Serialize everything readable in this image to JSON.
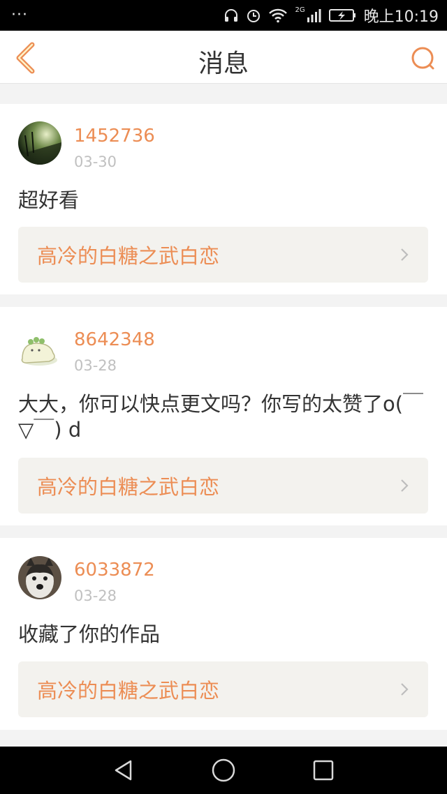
{
  "status_bar": {
    "dots": "···",
    "network": "2G",
    "time": "晚上10:19"
  },
  "header": {
    "title": "消息",
    "back_icon": "chevron-left-icon",
    "search_icon": "search-icon",
    "accent_color": "#ec8d54"
  },
  "messages": [
    {
      "user": "1452736",
      "date": "03-30",
      "text": "超好看",
      "work": "高冷的白糖之武白恋"
    },
    {
      "user": "8642348",
      "date": "03-28",
      "text": "大大，你可以快点更文吗？你写的太赞了o(￣▽￣) d",
      "work": "高冷的白糖之武白恋"
    },
    {
      "user": "6033872",
      "date": "03-28",
      "text": "收藏了你的作品",
      "work": "高冷的白糖之武白恋"
    }
  ],
  "system_nav": {
    "back_icon": "triangle-back-icon",
    "home_icon": "circle-home-icon",
    "recents_icon": "square-recents-icon"
  }
}
